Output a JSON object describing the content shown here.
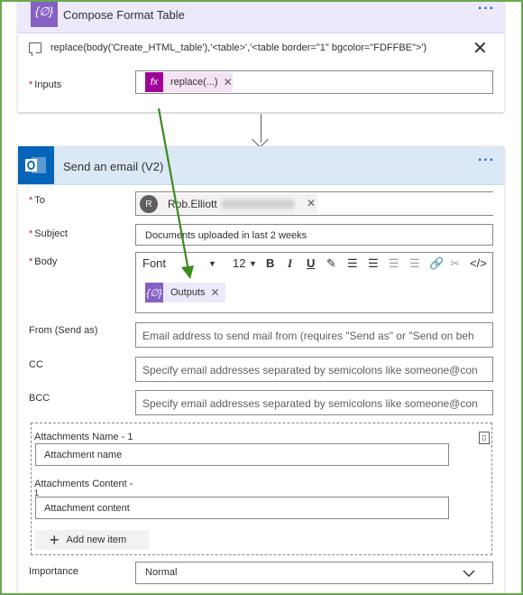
{
  "compose": {
    "title": "Compose Format Table",
    "menu": "···",
    "expression": "replace(body('Create_HTML_table'),'<table>','<table border=\"1\" bgcolor=\"FDFFBE\">')",
    "inputs_label": "Inputs",
    "inputs_token": "replace(...)",
    "token_icon": "fx",
    "close": "✕"
  },
  "email": {
    "title": "Send an email (V2)",
    "menu": "···",
    "to_label": "To",
    "to_avatar": "R",
    "to_value": "Rob.Elliott",
    "subject_label": "Subject",
    "subject_value": "Documents uploaded in last 2 weeks",
    "body_label": "Body",
    "toolbar": {
      "font": "Font",
      "size": "12"
    },
    "body_token": "Outputs",
    "from_label": "From (Send as)",
    "from_placeholder": "Email address to send mail from (requires \"Send as\" or \"Send on beh",
    "cc_label": "CC",
    "cc_placeholder": "Specify email addresses separated by semicolons like someone@con",
    "bcc_label": "BCC",
    "bcc_placeholder": "Specify email addresses separated by semicolons like someone@con",
    "attach_name_label": "Attachments Name - 1",
    "attach_name_placeholder": "Attachment name",
    "attach_content_label": "Attachments Content -",
    "attach_content_label2": "1",
    "attach_content_placeholder": "Attachment content",
    "add_item": "Add new item",
    "importance_label": "Importance",
    "importance_value": "Normal"
  },
  "colors": {
    "compose_accent": "#8661c5",
    "email_accent": "#0364b8",
    "annotation_arrow": "#3a8a1e",
    "frame_border": "#6aa84f"
  }
}
